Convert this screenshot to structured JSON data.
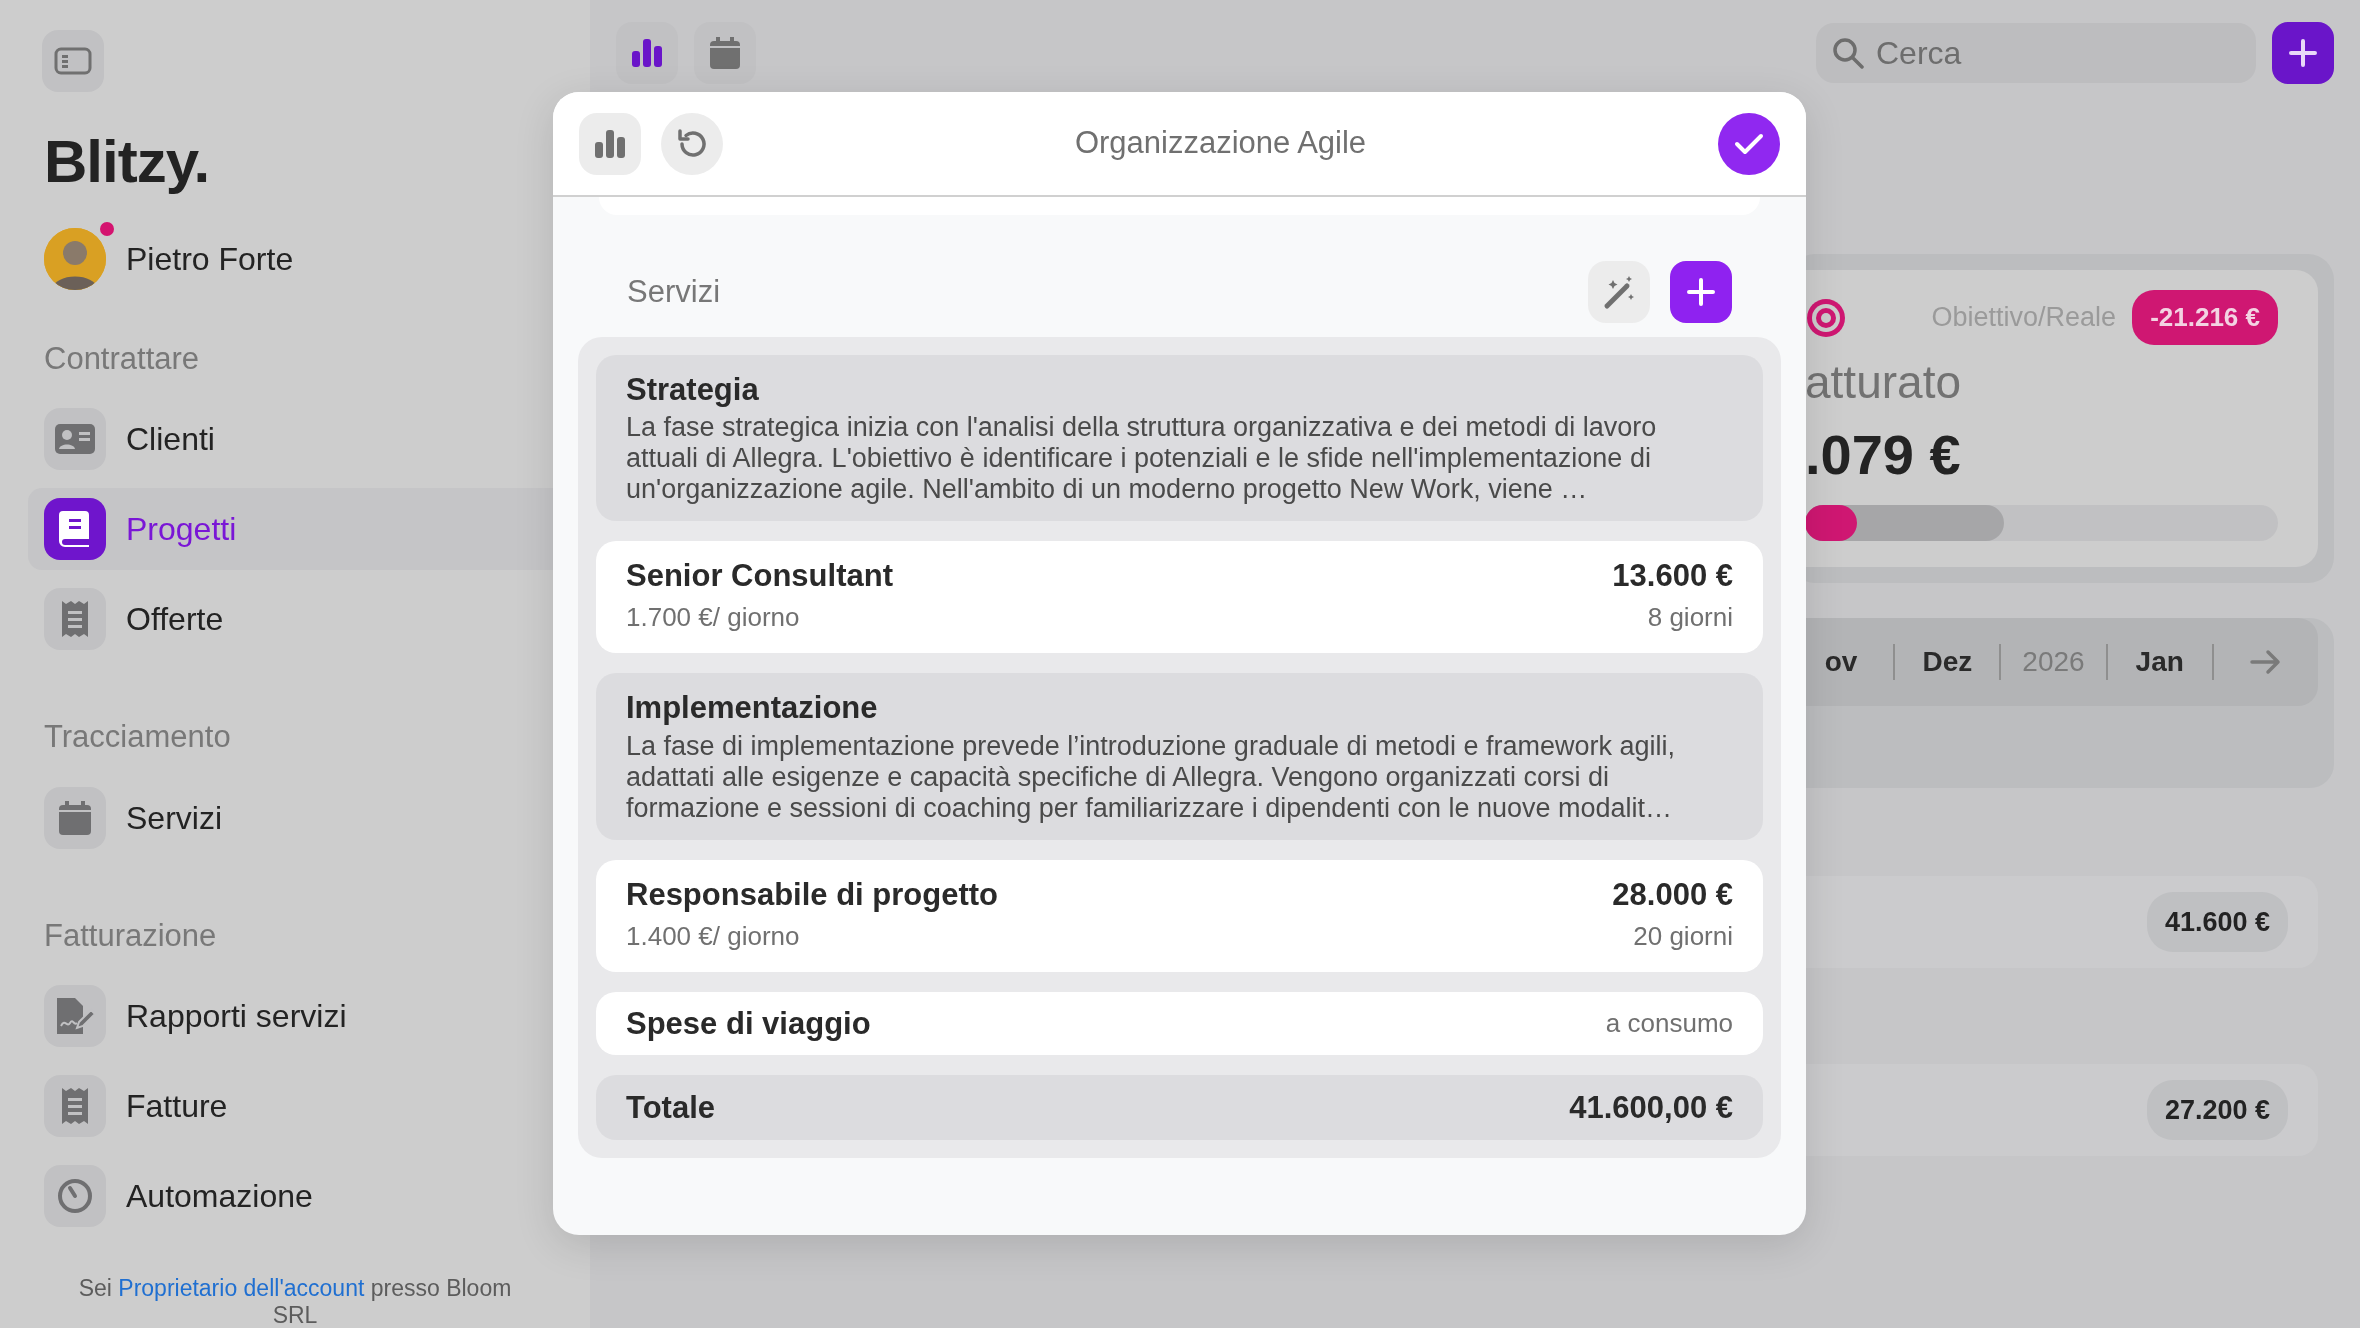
{
  "sidebar": {
    "logo": "Blitzy.",
    "user": {
      "name": "Pietro Forte",
      "notification": true
    },
    "groups": [
      {
        "title": "Contrattare",
        "items": [
          {
            "label": "Clienti",
            "selected": false
          },
          {
            "label": "Progetti",
            "selected": true
          },
          {
            "label": "Offerte",
            "selected": false
          }
        ]
      },
      {
        "title": "Tracciamento",
        "items": [
          {
            "label": "Servizi",
            "selected": false
          }
        ]
      },
      {
        "title": "Fatturazione",
        "items": [
          {
            "label": "Rapporti servizi",
            "selected": false
          },
          {
            "label": "Fatture",
            "selected": false
          },
          {
            "label": "Automazione",
            "selected": false
          }
        ]
      }
    ],
    "footer": {
      "before": "Sei",
      "link": "Proprietario dell'account",
      "after": "presso Bloom SRL"
    }
  },
  "toolbar": {
    "views": [
      {
        "selected": true
      },
      {
        "selected": false
      }
    ]
  },
  "search": {
    "placeholder": "Cerca"
  },
  "modal": {
    "title": "Organizzazione Agile",
    "section": "Servizi",
    "items": [
      {
        "kind": "description",
        "title": "Strategia",
        "text": "La fase strategica inizia con l'analisi della struttura organizzativa e dei metodi di lavoro attuali di Allegra. L'obiettivo è identificare i potenziali e le sfide nell'implementazione di un'organizzazione agile. Nell'ambito di un moderno progetto New Work, viene …"
      },
      {
        "kind": "position",
        "title": "Senior Consultant",
        "rate": "1.700 €/ giorno",
        "amount": "13.600 €",
        "days": "8 giorni"
      },
      {
        "kind": "description",
        "title": "Implementazione",
        "text": "La fase di implementazione prevede l’introduzione graduale di metodi e framework agili, adattati alle esigenze e capacità specifiche di Allegra. Vengono organizzati corsi di formazione e sessioni di coaching per familiarizzare i dipendenti con le nuove modalit…"
      },
      {
        "kind": "position",
        "title": "Responsabile di progetto",
        "rate": "1.400 €/ giorno",
        "amount": "28.000 €",
        "days": "20 giorni"
      },
      {
        "kind": "expense",
        "title": "Spese di viaggio",
        "note": "a consumo"
      },
      {
        "kind": "total",
        "title": "Totale",
        "amount": "41.600,00 €"
      }
    ]
  },
  "dashboard": {
    "goal_label": "Obiettivo/Reale",
    "goal_delta": "-21.216 €",
    "title": "atturato",
    "value": ".079 €",
    "progress": [
      {
        "level": 0.11
      },
      {
        "level": 0.42
      }
    ],
    "periods": [
      {
        "label": "ov",
        "kind": "month"
      },
      {
        "label": "Dez",
        "kind": "month"
      },
      {
        "label": "2026",
        "kind": "year"
      },
      {
        "label": "Jan",
        "kind": "month"
      }
    ],
    "rows": [
      {
        "amount": "41.600 €"
      },
      {
        "amount": "27.200 €"
      }
    ]
  }
}
